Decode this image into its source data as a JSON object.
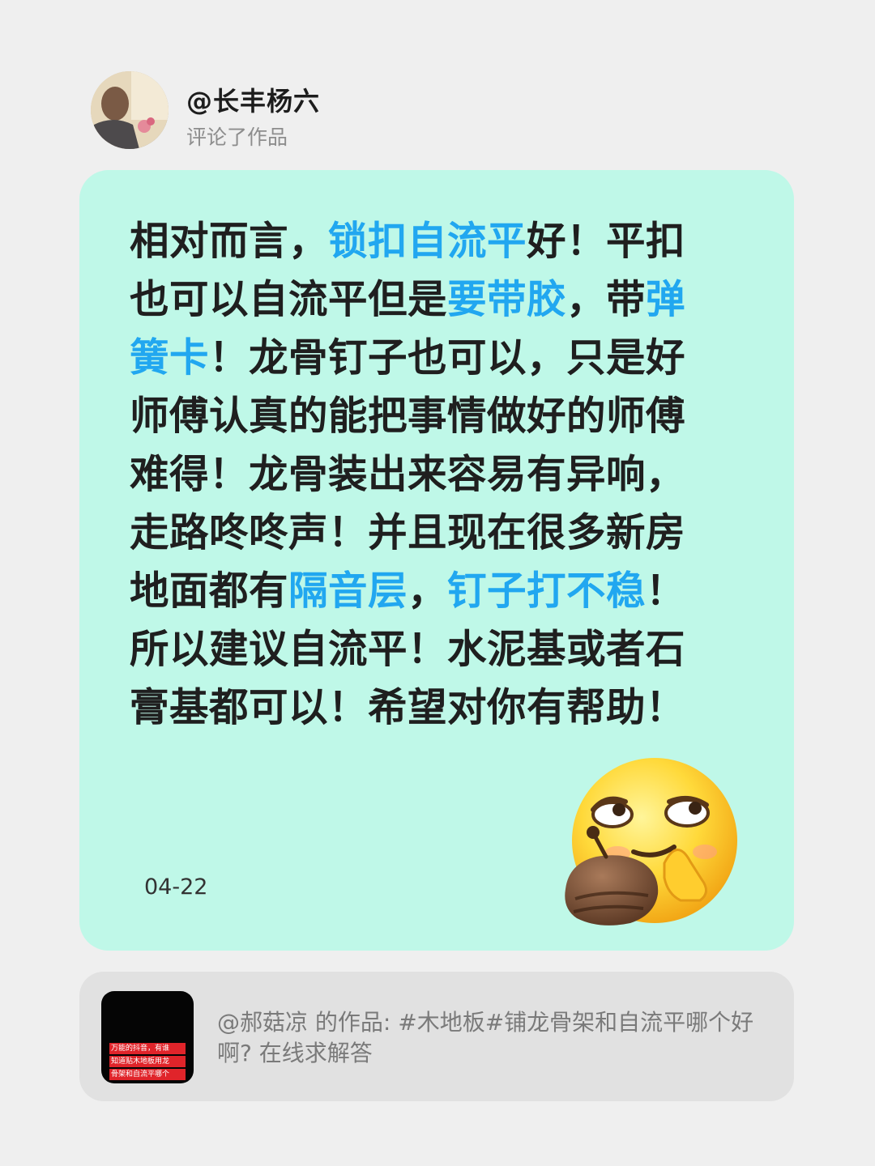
{
  "header": {
    "username": "@长丰杨六",
    "action": "评论了作品"
  },
  "comment": {
    "segments": [
      {
        "text": "相对而言，",
        "highlight": false
      },
      {
        "text": "锁扣自流平",
        "highlight": true
      },
      {
        "text": "好！平扣也可以自流平但是",
        "highlight": false
      },
      {
        "text": "要带胶",
        "highlight": true
      },
      {
        "text": "，带",
        "highlight": false
      },
      {
        "text": "弹簧卡",
        "highlight": true
      },
      {
        "text": "！龙骨钉子也可以，只是好师傅认真的能把事情做好的师傅难得！龙骨装出来容易有异响，走路咚咚声！并且现在很多新房地面都有",
        "highlight": false
      },
      {
        "text": "隔音层",
        "highlight": true
      },
      {
        "text": "，",
        "highlight": false
      },
      {
        "text": "钉子打不稳",
        "highlight": true
      },
      {
        "text": "！所以建议自流平！水泥基或者石膏基都可以！希望对你有帮助！",
        "highlight": false
      }
    ],
    "date": "04-22",
    "emoji": "thinking-smirk-emoji"
  },
  "source": {
    "text": "@郝菇凉 的作品: #木地板#铺龙骨架和自流平哪个好啊? 在线求解答",
    "thumbnail_lines": [
      "万能的抖音，有谁",
      "知道贴木地板用龙",
      "骨架和自流平哪个"
    ]
  },
  "colors": {
    "background": "#efefef",
    "card": "#bff8e8",
    "highlight": "#21a7f0",
    "source_card": "#e1e1e1"
  }
}
